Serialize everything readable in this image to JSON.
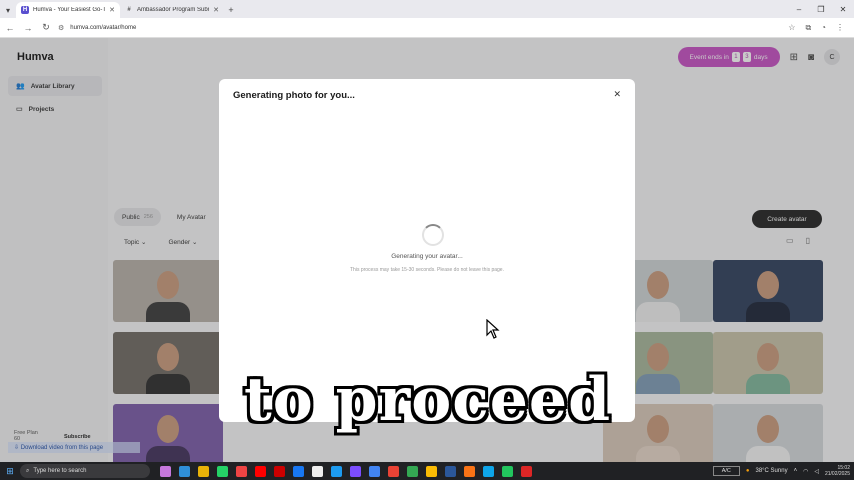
{
  "browser": {
    "tabs": [
      {
        "title": "Humva - Your Easiest Go-To AI",
        "active": true,
        "favicon": "H"
      },
      {
        "title": "Ambassador Program Submiss...",
        "active": false,
        "favicon": "#"
      }
    ],
    "url": "humva.com/avatar/home"
  },
  "app": {
    "logo": "Humva",
    "sidebar": [
      {
        "label": "Avatar Library",
        "icon": "users-icon",
        "active": true
      },
      {
        "label": "Projects",
        "icon": "folder-icon",
        "active": false
      }
    ],
    "event": {
      "text": "Event ends in",
      "d1": "1",
      "d2": "3",
      "suffix": "days"
    },
    "user_initial": "C",
    "filters": {
      "public": "Public",
      "public_count": "256",
      "my_avatar": "My Avatar"
    },
    "subfilters": {
      "topic": "Topic",
      "gender": "Gender"
    },
    "create_button": "Create avatar",
    "plan": {
      "label": "Free Plan",
      "credits": "60",
      "subscribe": "Subscribe"
    }
  },
  "modal": {
    "title": "Generating photo for you...",
    "status": "Generating your avatar...",
    "note": "This process may take 15-30 seconds. Please do not leave this page."
  },
  "caption": "to proceed",
  "download_bar": "Download video from this page",
  "taskbar": {
    "search_placeholder": "Type here to search",
    "input_indicator": "A/C",
    "weather": "38°C  Sunny",
    "time": "15:02",
    "date": "21/02/2025"
  }
}
